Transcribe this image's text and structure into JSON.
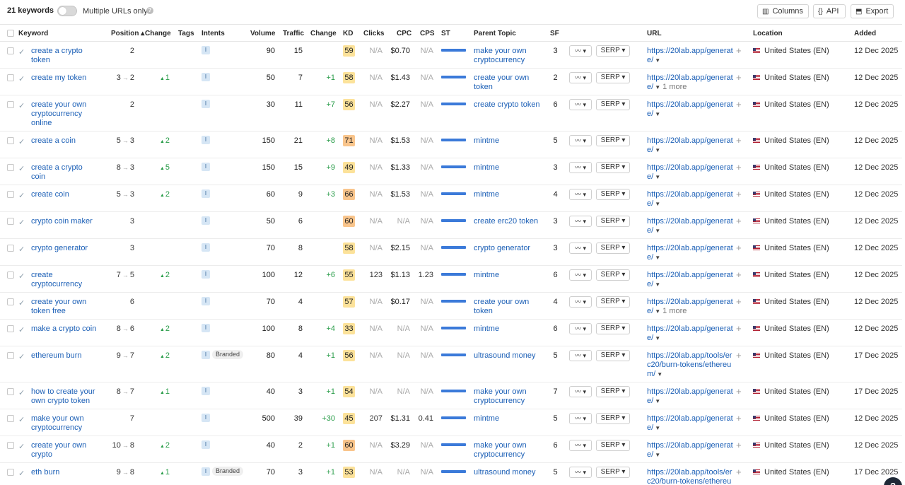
{
  "topbar": {
    "keyword_count": "21 keywords",
    "toggle_label": "Multiple URLs only",
    "help_icon": "?",
    "columns_label": "Columns",
    "api_label": "API",
    "export_label": "Export"
  },
  "headers": {
    "keyword": "Keyword",
    "position": "Position ▴",
    "change": "Change",
    "tags": "Tags",
    "intents": "Intents",
    "volume": "Volume",
    "traffic": "Traffic",
    "change2": "Change",
    "kd": "KD",
    "clicks": "Clicks",
    "cpc": "CPC",
    "cps": "CPS",
    "st": "ST",
    "parent_topic": "Parent Topic",
    "sf": "SF",
    "url": "URL",
    "location": "Location",
    "added": "Added"
  },
  "colors": {
    "kd_yellow": "#fce29a",
    "kd_orange": "#f9c58c",
    "link": "#1b5fb6",
    "positive": "#2a9d4a"
  },
  "rows": [
    {
      "keyword": "create a crypto token",
      "prev": "",
      "pos": "2",
      "change": "",
      "intent": "I",
      "tag": "",
      "volume": "90",
      "traffic": "15",
      "traffic_change": "",
      "kd": "59",
      "kd_color": "#fce29a",
      "clicks": "N/A",
      "cpc": "$0.70",
      "cps": "N/A",
      "parent_topic": "make your own cryptocurrency",
      "sf": "3",
      "serp": "SERP",
      "url": "https://20lab.app/generate/",
      "more": "",
      "location": "United States (EN)",
      "added": "12 Dec 2025"
    },
    {
      "keyword": "create my token",
      "prev": "3",
      "pos": "2",
      "change": "1",
      "intent": "",
      "tag": "",
      "volume": "50",
      "traffic": "7",
      "traffic_change": "+1",
      "kd": "58",
      "kd_color": "#fce29a",
      "clicks": "N/A",
      "cpc": "$1.43",
      "cps": "N/A",
      "parent_topic": "create your own token",
      "sf": "2",
      "serp": "SERP",
      "url": "https://20lab.app/generate/",
      "more": "1 more",
      "location": "United States (EN)",
      "added": "12 Dec 2025"
    },
    {
      "keyword": "create your own cryptocurrency online",
      "prev": "",
      "pos": "2",
      "change": "",
      "intent": "I",
      "tag": "",
      "volume": "30",
      "traffic": "11",
      "traffic_change": "+7",
      "kd": "56",
      "kd_color": "#fce29a",
      "clicks": "N/A",
      "cpc": "$2.27",
      "cps": "N/A",
      "parent_topic": "create crypto token",
      "sf": "6",
      "serp": "SERP",
      "url": "https://20lab.app/generate/",
      "more": "",
      "location": "United States (EN)",
      "added": "12 Dec 2025"
    },
    {
      "keyword": "create a coin",
      "prev": "5",
      "pos": "3",
      "change": "2",
      "intent": "I",
      "tag": "",
      "volume": "150",
      "traffic": "21",
      "traffic_change": "+8",
      "kd": "71",
      "kd_color": "#f9c58c",
      "clicks": "N/A",
      "cpc": "$1.53",
      "cps": "N/A",
      "parent_topic": "mintme",
      "sf": "5",
      "serp": "SERP",
      "url": "https://20lab.app/generate/",
      "more": "",
      "location": "United States (EN)",
      "added": "12 Dec 2025"
    },
    {
      "keyword": "create a crypto coin",
      "prev": "8",
      "pos": "3",
      "change": "5",
      "intent": "I",
      "tag": "",
      "volume": "150",
      "traffic": "15",
      "traffic_change": "+9",
      "kd": "49",
      "kd_color": "#fce29a",
      "clicks": "N/A",
      "cpc": "$1.33",
      "cps": "N/A",
      "parent_topic": "mintme",
      "sf": "3",
      "serp": "SERP",
      "url": "https://20lab.app/generate/",
      "more": "",
      "location": "United States (EN)",
      "added": "12 Dec 2025"
    },
    {
      "keyword": "create coin",
      "prev": "5",
      "pos": "3",
      "change": "2",
      "intent": "I",
      "tag": "",
      "volume": "60",
      "traffic": "9",
      "traffic_change": "+3",
      "kd": "66",
      "kd_color": "#f9c58c",
      "clicks": "N/A",
      "cpc": "$1.53",
      "cps": "N/A",
      "parent_topic": "mintme",
      "sf": "4",
      "serp": "SERP",
      "url": "https://20lab.app/generate/",
      "more": "",
      "location": "United States (EN)",
      "added": "12 Dec 2025"
    },
    {
      "keyword": "crypto coin maker",
      "prev": "",
      "pos": "3",
      "change": "",
      "intent": "I",
      "tag": "",
      "volume": "50",
      "traffic": "6",
      "traffic_change": "",
      "kd": "60",
      "kd_color": "#f9c58c",
      "clicks": "N/A",
      "cpc": "N/A",
      "cps": "N/A",
      "parent_topic": "create erc20 token",
      "sf": "3",
      "serp": "SERP",
      "url": "https://20lab.app/generate/",
      "more": "",
      "location": "United States (EN)",
      "added": "12 Dec 2025"
    },
    {
      "keyword": "crypto generator",
      "prev": "",
      "pos": "3",
      "change": "",
      "intent": "I",
      "tag": "",
      "volume": "70",
      "traffic": "8",
      "traffic_change": "",
      "kd": "58",
      "kd_color": "#fce29a",
      "clicks": "N/A",
      "cpc": "$2.15",
      "cps": "N/A",
      "parent_topic": "crypto generator",
      "sf": "3",
      "serp": "SERP",
      "url": "https://20lab.app/generate/",
      "more": "",
      "location": "United States (EN)",
      "added": "12 Dec 2025"
    },
    {
      "keyword": "create cryptocurrency",
      "prev": "7",
      "pos": "5",
      "change": "2",
      "intent": "I",
      "tag": "",
      "volume": "100",
      "traffic": "12",
      "traffic_change": "+6",
      "kd": "55",
      "kd_color": "#fce29a",
      "clicks": "123",
      "cpc": "$1.13",
      "cps": "1.23",
      "parent_topic": "mintme",
      "sf": "6",
      "serp": "SERP",
      "url": "https://20lab.app/generate/",
      "more": "",
      "location": "United States (EN)",
      "added": "12 Dec 2025"
    },
    {
      "keyword": "create your own token free",
      "prev": "",
      "pos": "6",
      "change": "",
      "intent": "I",
      "tag": "",
      "volume": "70",
      "traffic": "4",
      "traffic_change": "",
      "kd": "57",
      "kd_color": "#fce29a",
      "clicks": "N/A",
      "cpc": "$0.17",
      "cps": "N/A",
      "parent_topic": "create your own token",
      "sf": "4",
      "serp": "SERP",
      "url": "https://20lab.app/generate/",
      "more": "1 more",
      "location": "United States (EN)",
      "added": "12 Dec 2025"
    },
    {
      "keyword": "make a crypto coin",
      "prev": "8",
      "pos": "6",
      "change": "2",
      "intent": "I",
      "tag": "",
      "volume": "100",
      "traffic": "8",
      "traffic_change": "+4",
      "kd": "33",
      "kd_color": "#fce29a",
      "clicks": "N/A",
      "cpc": "N/A",
      "cps": "N/A",
      "parent_topic": "mintme",
      "sf": "6",
      "serp": "SERP",
      "url": "https://20lab.app/generate/",
      "more": "",
      "location": "United States (EN)",
      "added": "12 Dec 2025"
    },
    {
      "keyword": "ethereum burn",
      "prev": "9",
      "pos": "7",
      "change": "2",
      "intent": "I",
      "tag": "Branded",
      "volume": "80",
      "traffic": "4",
      "traffic_change": "+1",
      "kd": "56",
      "kd_color": "#fce29a",
      "clicks": "N/A",
      "cpc": "N/A",
      "cps": "N/A",
      "parent_topic": "ultrasound money",
      "sf": "5",
      "serp": "SERP",
      "url": "https://20lab.app/tools/erc20/burn-tokens/ethereum/",
      "more": "",
      "location": "United States (EN)",
      "added": "17 Dec 2025"
    },
    {
      "keyword": "how to create your own crypto token",
      "prev": "8",
      "pos": "7",
      "change": "1",
      "intent": "I",
      "tag": "",
      "volume": "40",
      "traffic": "3",
      "traffic_change": "+1",
      "kd": "54",
      "kd_color": "#fce29a",
      "clicks": "N/A",
      "cpc": "N/A",
      "cps": "N/A",
      "parent_topic": "make your own cryptocurrency",
      "sf": "7",
      "serp": "SERP",
      "url": "https://20lab.app/generate/",
      "more": "",
      "location": "United States (EN)",
      "added": "17 Dec 2025"
    },
    {
      "keyword": "make your own cryptocurrency",
      "prev": "",
      "pos": "7",
      "change": "",
      "intent": "I",
      "tag": "",
      "volume": "500",
      "traffic": "39",
      "traffic_change": "+30",
      "kd": "45",
      "kd_color": "#fce29a",
      "clicks": "207",
      "cpc": "$1.31",
      "cps": "0.41",
      "parent_topic": "mintme",
      "sf": "5",
      "serp": "SERP",
      "url": "https://20lab.app/generate/",
      "more": "",
      "location": "United States (EN)",
      "added": "12 Dec 2025"
    },
    {
      "keyword": "create your own crypto",
      "prev": "10",
      "pos": "8",
      "change": "2",
      "intent": "I",
      "tag": "",
      "volume": "40",
      "traffic": "2",
      "traffic_change": "+1",
      "kd": "60",
      "kd_color": "#f9c58c",
      "clicks": "N/A",
      "cpc": "$3.29",
      "cps": "N/A",
      "parent_topic": "make your own cryptocurrency",
      "sf": "6",
      "serp": "SERP",
      "url": "https://20lab.app/generate/",
      "more": "",
      "location": "United States (EN)",
      "added": "12 Dec 2025"
    },
    {
      "keyword": "eth burn",
      "prev": "9",
      "pos": "8",
      "change": "1",
      "intent": "I",
      "tag": "Branded",
      "volume": "70",
      "traffic": "3",
      "traffic_change": "+1",
      "kd": "53",
      "kd_color": "#fce29a",
      "clicks": "N/A",
      "cpc": "N/A",
      "cps": "N/A",
      "parent_topic": "ultrasound money",
      "sf": "5",
      "serp": "SERP",
      "url": "https://20lab.app/tools/erc20/burn-tokens/ethereum/",
      "more": "",
      "location": "United States (EN)",
      "added": "17 Dec 2025"
    }
  ]
}
